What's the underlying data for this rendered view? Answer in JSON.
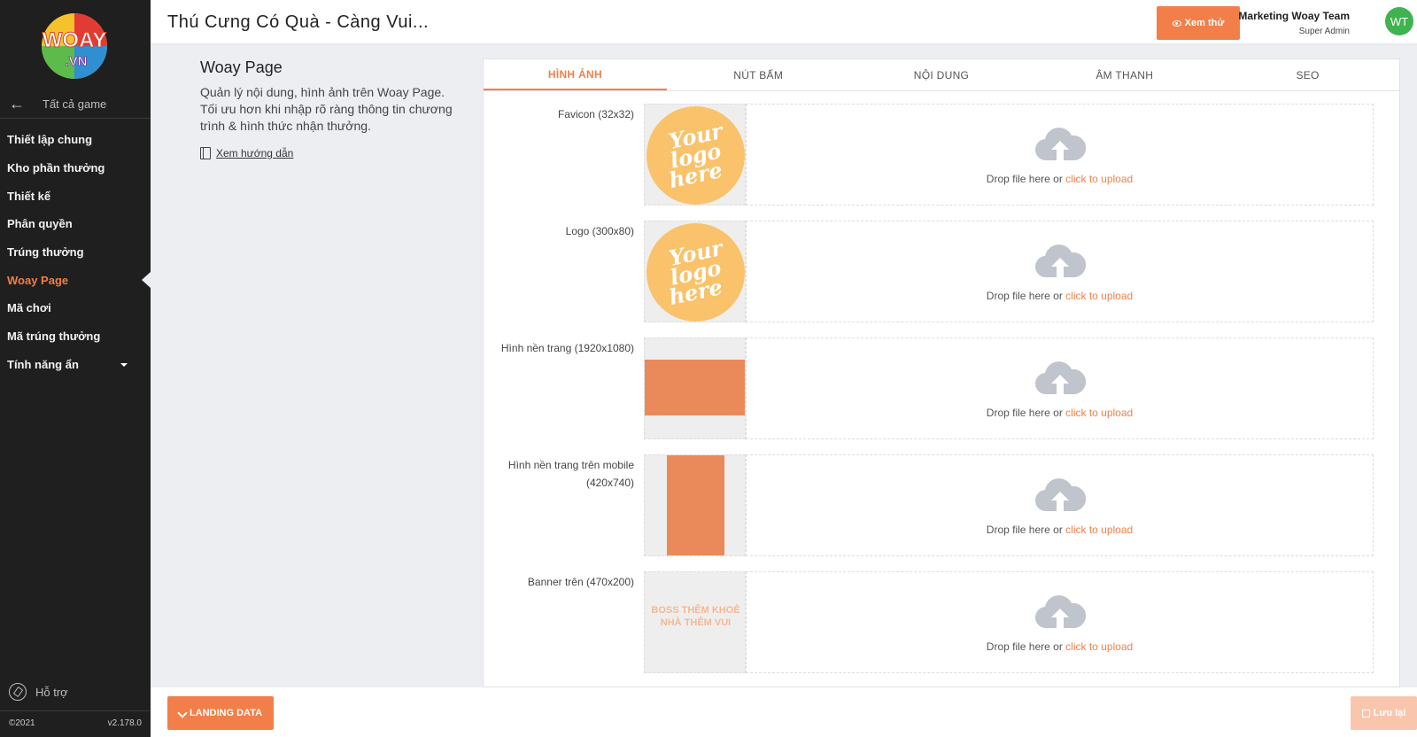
{
  "brand": {
    "logo_text_top": "WOAY",
    "logo_text_bottom": ".VN"
  },
  "sidebar": {
    "back_label": "Tất cả game",
    "items": [
      {
        "label": "Thiết lập chung"
      },
      {
        "label": "Kho phần thưởng"
      },
      {
        "label": "Thiết kế"
      },
      {
        "label": "Phân quyền"
      },
      {
        "label": "Trúng thưởng"
      },
      {
        "label": "Woay Page",
        "active": true
      },
      {
        "label": "Mã chơi"
      },
      {
        "label": "Mã trúng thưởng"
      },
      {
        "label": "Tính năng ẩn"
      }
    ],
    "support_label": "Hỗ trợ",
    "copyright": "©2021",
    "version": "v2.178.0"
  },
  "header": {
    "title": "Thú Cưng Có Quà - Càng Vui...",
    "preview_label": "Xem thử",
    "user_name": "Marketing Woay Team",
    "user_role": "Super Admin",
    "avatar_initials": "WT"
  },
  "intro": {
    "title": "Woay Page",
    "description": "Quản lý nội dung, hình ảnh trên Woay Page. Tối ưu hơn khi nhập rõ ràng thông tin chương trình & hình thức nhận thưởng.",
    "guide_label": "Xem hướng dẫn"
  },
  "tabs": [
    {
      "label": "HÌNH ẢNH",
      "active": true
    },
    {
      "label": "NÚT BẤM"
    },
    {
      "label": "NỘI DUNG"
    },
    {
      "label": "ÂM THANH"
    },
    {
      "label": "SEO"
    }
  ],
  "upload": {
    "drop_text": "Drop file here or ",
    "drop_link": "click to upload",
    "rows": [
      {
        "label": "Favicon (32x32)",
        "thumb": "logo"
      },
      {
        "label": "Logo (300x80)",
        "thumb": "logo"
      },
      {
        "label": "Hình nền trang (1920x1080)",
        "thumb": "landscape"
      },
      {
        "label": "Hình nền trang trên mobile (420x740)",
        "thumb": "portrait"
      },
      {
        "label": "Banner trên (470x200)",
        "thumb": "banner"
      }
    ],
    "logo_placeholder_lines": [
      "Your",
      "logo",
      "here"
    ],
    "banner_text_lines": [
      "BOSS THÊM KHOẺ",
      "NHÀ THÊM VUI"
    ]
  },
  "footer": {
    "landing_label": "LANDING DATA",
    "save_label": "Lưu lại"
  },
  "colors": {
    "accent": "#f27f4a",
    "sidebar": "#1f1f1f",
    "avatar": "#3fb34f"
  }
}
